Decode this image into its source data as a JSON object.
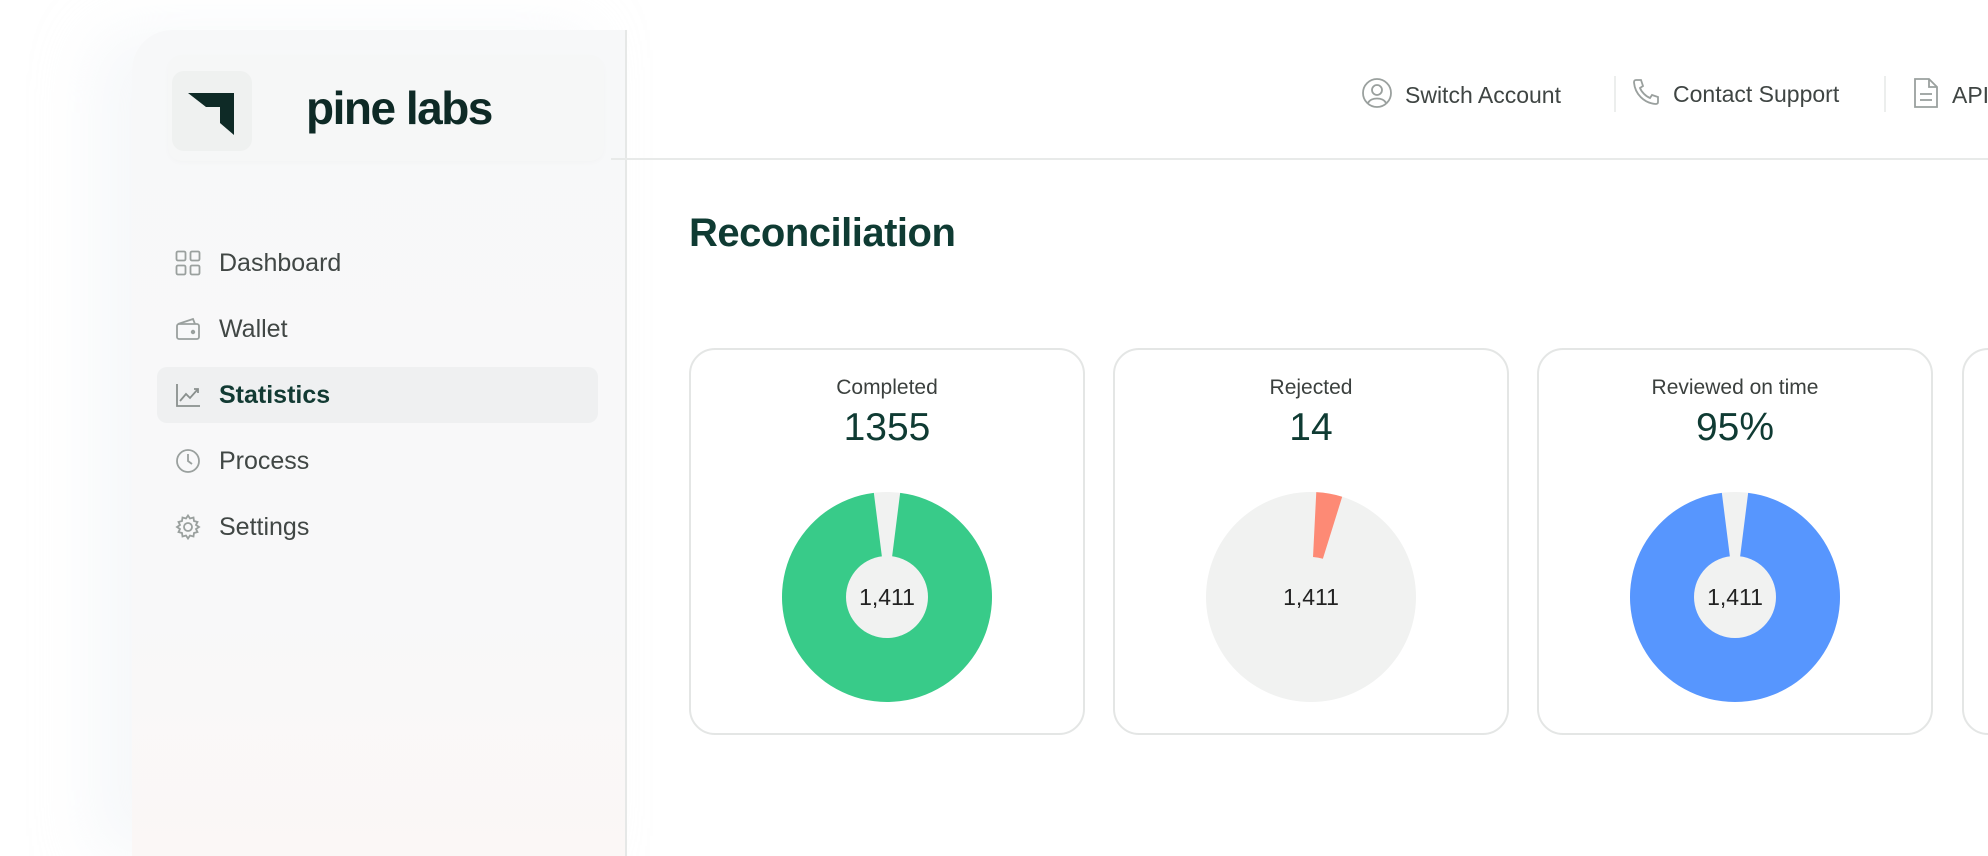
{
  "brand": {
    "name": "pine labs"
  },
  "sidebar": {
    "items": [
      {
        "label": "Dashboard",
        "icon": "grid-icon",
        "active": false
      },
      {
        "label": "Wallet",
        "icon": "wallet-icon",
        "active": false
      },
      {
        "label": "Statistics",
        "icon": "chart-icon",
        "active": true
      },
      {
        "label": "Process",
        "icon": "clock-icon",
        "active": false
      },
      {
        "label": "Settings",
        "icon": "gear-icon",
        "active": false
      }
    ]
  },
  "topbar": {
    "switch_account": "Switch Account",
    "contact_support": "Contact Support",
    "api": "API"
  },
  "page": {
    "title": "Reconciliation"
  },
  "cards": [
    {
      "label": "Completed",
      "value": "1355",
      "center": "1,411",
      "color": "#38cb89",
      "style": "donut",
      "fraction": 0.96
    },
    {
      "label": "Rejected",
      "value": "14",
      "center": "1,411",
      "color": "#fd8a75",
      "style": "pie-slice",
      "fraction": 0.04
    },
    {
      "label": "Reviewed on time",
      "value": "95%",
      "center": "1,411",
      "color": "#5796fe",
      "style": "donut",
      "fraction": 0.96
    }
  ],
  "colors": {
    "accent": "#0f3b33",
    "track": "#f1f2f1",
    "border": "#e4e6e5"
  }
}
